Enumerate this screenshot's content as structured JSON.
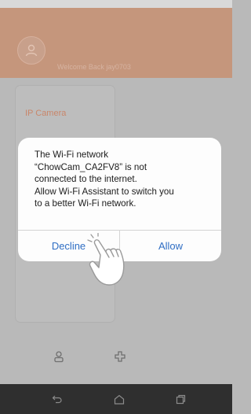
{
  "header": {
    "welcome_text": "Welcome Back jay0703"
  },
  "card": {
    "title": "IP Camera"
  },
  "dialog": {
    "message": "The Wi-Fi network\n  “ChowCam_CA2FV8” is not\nconnected to the internet.\nAllow Wi-Fi Assistant to switch you\nto a better Wi-Fi network.",
    "decline_label": "Decline",
    "allow_label": "Allow"
  },
  "icons": {
    "avatar": "user-avatar-icon",
    "bottom_left": "person-icon",
    "bottom_right": "add-icon",
    "nav_back": "back-icon",
    "nav_home": "home-icon",
    "nav_recents": "recents-icon",
    "tap_hint": "tap-hand-icon"
  },
  "colors": {
    "header": "#c5967c",
    "dialog_button": "#2f6ec4",
    "nav_bar": "#2f2f2f"
  }
}
